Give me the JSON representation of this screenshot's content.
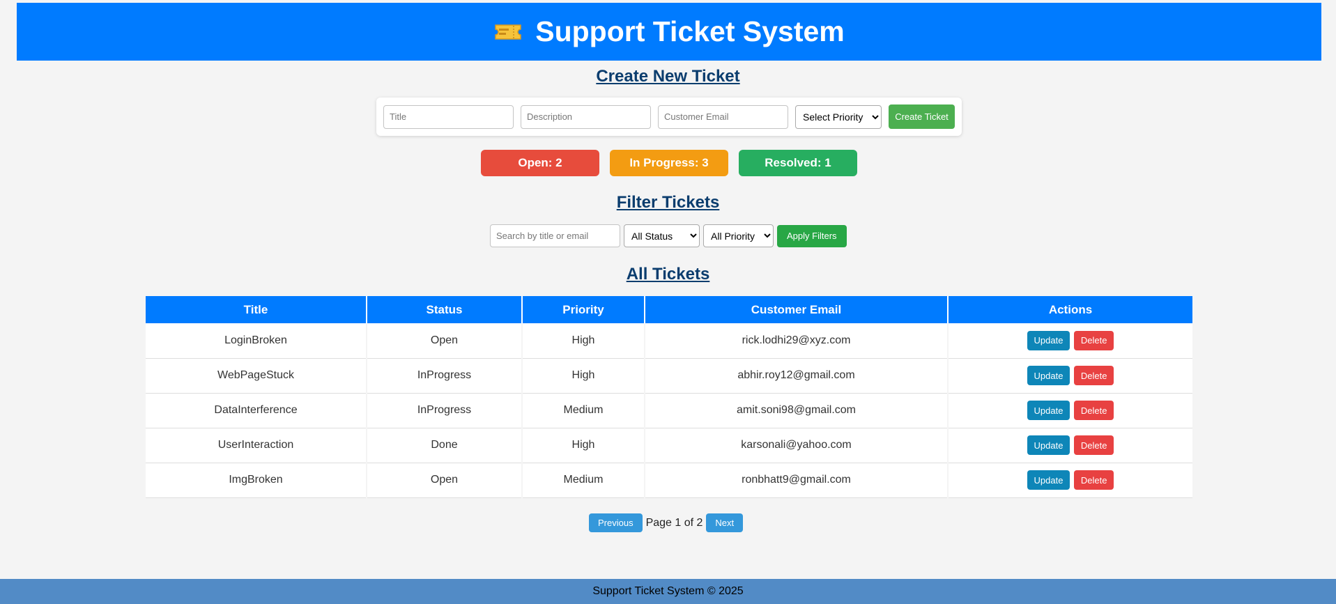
{
  "header": {
    "title": "Support Ticket System",
    "icon": "ticket-icon"
  },
  "create": {
    "heading": "Create New Ticket",
    "title_placeholder": "Title",
    "description_placeholder": "Description",
    "email_placeholder": "Customer Email",
    "priority_selected": "Select Priority",
    "submit_label": "Create Ticket"
  },
  "stats": {
    "open": "Open: 2",
    "in_progress": "In Progress: 3",
    "resolved": "Resolved: 1",
    "colors": {
      "open": "#e74c3c",
      "in_progress": "#f39c12",
      "resolved": "#27ae60"
    }
  },
  "filter": {
    "heading": "Filter Tickets",
    "search_placeholder": "Search by title or email",
    "status_selected": "All Status",
    "priority_selected": "All Priority",
    "apply_label": "Apply Filters"
  },
  "tickets": {
    "heading": "All Tickets",
    "columns": [
      "Title",
      "Status",
      "Priority",
      "Customer Email",
      "Actions"
    ],
    "rows": [
      {
        "title": "LoginBroken",
        "status": "Open",
        "priority": "High",
        "email": "rick.lodhi29@xyz.com"
      },
      {
        "title": "WebPageStuck",
        "status": "InProgress",
        "priority": "High",
        "email": "abhir.roy12@gmail.com"
      },
      {
        "title": "DataInterference",
        "status": "InProgress",
        "priority": "Medium",
        "email": "amit.soni98@gmail.com"
      },
      {
        "title": "UserInteraction",
        "status": "Done",
        "priority": "High",
        "email": "karsonali@yahoo.com"
      },
      {
        "title": "ImgBroken",
        "status": "Open",
        "priority": "Medium",
        "email": "ronbhatt9@gmail.com"
      }
    ],
    "update_label": "Update",
    "delete_label": "Delete"
  },
  "pagination": {
    "previous_label": "Previous",
    "info": "Page 1 of 2",
    "next_label": "Next"
  },
  "footer": {
    "text": "Support Ticket System © 2025"
  }
}
